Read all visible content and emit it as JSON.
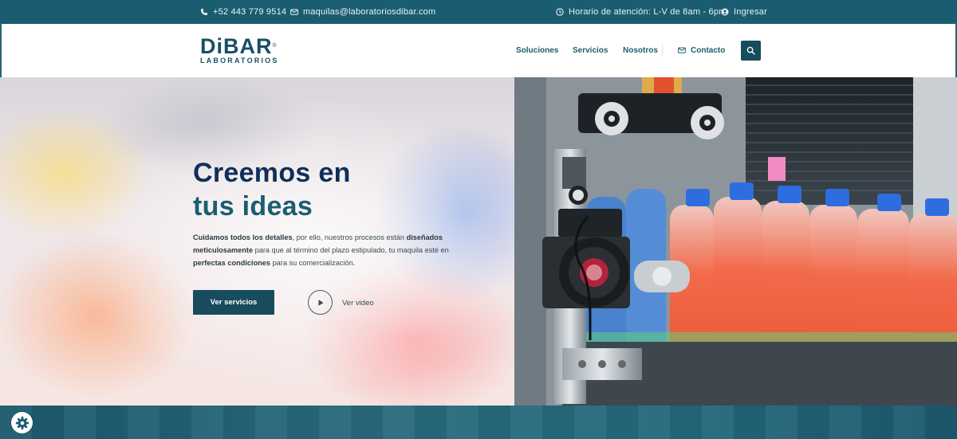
{
  "topbar": {
    "phone": "+52 443 779 9514",
    "email": "maquilas@laboratoriosdibar.com",
    "hours": "Horario de atención: L-V de 8am - 6pm",
    "login": "Ingresar"
  },
  "header": {
    "logo_main": "DiBAR",
    "logo_sub": "LABORATORIOS",
    "nav": [
      "Soluciones",
      "Servicios",
      "Nosotros"
    ],
    "contact": "Contacto"
  },
  "hero": {
    "title_line1": "Creemos en",
    "title_line2": "tus ideas",
    "text": {
      "p1": "Cuidamos todos los detalles",
      "p2": ", por ello, nuestros procesos están ",
      "p3": "diseñados meticulosamente",
      "p4": " para que al término del plazo estipulado, tu maquila esté en ",
      "p5": "perfectas condiciones",
      "p6": " para su comercialización."
    },
    "cta": "Ver servicios",
    "video": "Ver video"
  },
  "colors": {
    "brand_dark": "#174b5e",
    "topbar": "#1b5d70",
    "title_navy": "#0f2f57"
  },
  "icons": [
    "phone-icon",
    "mail-icon",
    "clock-icon",
    "user-icon",
    "search-icon",
    "play-icon",
    "gear-icon"
  ]
}
